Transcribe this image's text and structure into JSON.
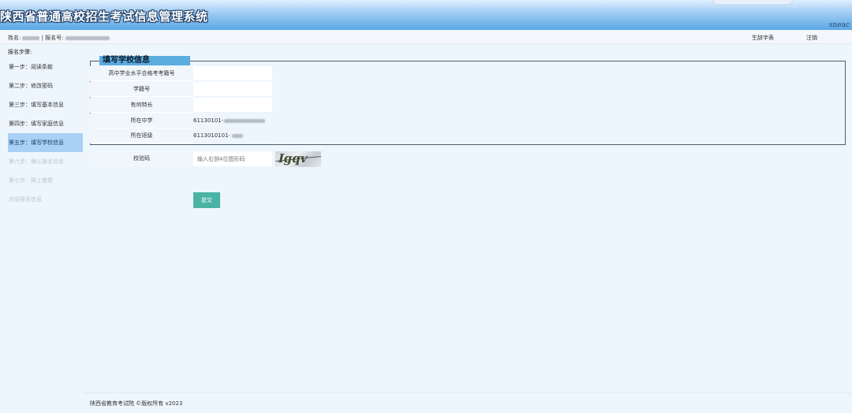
{
  "header": {
    "title": "陕西省普通高校招生考试信息管理系统",
    "logo_text": "sneac"
  },
  "userbar": {
    "name_label": "姓名:",
    "separator": "| 报名号:",
    "link_print": "生辞字表",
    "link_logout": "注销"
  },
  "sidebar": {
    "title": "报名步骤:",
    "items": [
      {
        "label": "第一步：阅读条款",
        "state": "normal"
      },
      {
        "label": "第二步：修改密码",
        "state": "normal"
      },
      {
        "label": "第三步：填写基本信息",
        "state": "normal"
      },
      {
        "label": "第四步：填写家庭信息",
        "state": "normal"
      },
      {
        "label": "第五步：填写学校信息",
        "state": "active"
      },
      {
        "label": "第六步：确认报名信息",
        "state": "disabled"
      },
      {
        "label": "第七步：网上缴费",
        "state": "disabled"
      },
      {
        "label": "浏览报名信息",
        "state": "disabled"
      }
    ]
  },
  "form": {
    "legend": "填写学校信息",
    "rows": [
      {
        "label": "高中学业水平合格考考籍号",
        "value": ""
      },
      {
        "label": "学籍号",
        "value": ""
      },
      {
        "label": "有何特长",
        "value": ""
      },
      {
        "label": "所在中学",
        "value": "61130101-"
      },
      {
        "label": "所在班级",
        "value": "6113010101·"
      }
    ],
    "captcha_label": "校验码",
    "captcha_placeholder": "输入右侧4位图形码",
    "captcha_image_text": "Igqv",
    "submit_label": "提交"
  },
  "footer": {
    "text": "陕西省教育考试院 ©版权所有 v2023"
  },
  "colors": {
    "banner_bottom": "#5aa9e6",
    "active_step": "#a9d0f5",
    "legend_bg": "#5bacdf",
    "submit_bg": "#49b3a4"
  }
}
